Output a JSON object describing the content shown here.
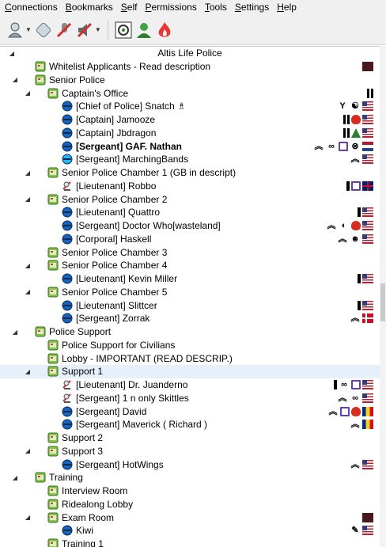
{
  "menu": [
    {
      "u": "C",
      "rest": "onnections"
    },
    {
      "u": "B",
      "rest": "ookmarks"
    },
    {
      "u": "S",
      "rest": "elf"
    },
    {
      "u": "P",
      "rest": "ermissions"
    },
    {
      "u": "T",
      "rest": "ools"
    },
    {
      "u": "S",
      "rest": "ettings"
    },
    {
      "u": "H",
      "rest": "elp"
    }
  ],
  "toolbar": [
    "connect-icon",
    "disconnect-icon",
    "mute-icon",
    "deafen-icon",
    "target-icon",
    "user-info-icon",
    "fire-icon"
  ],
  "root": "Altis Life Police",
  "tree": [
    {
      "type": "channel",
      "depth": 1,
      "label": "Whitelist Applicants - Read description",
      "badges": [
        "m"
      ]
    },
    {
      "type": "channel",
      "depth": 1,
      "label": "Senior Police",
      "expanded": true,
      "badges": []
    },
    {
      "type": "channel",
      "depth": 2,
      "label": "Captain's Office",
      "expanded": true,
      "badges": [
        "pause"
      ]
    },
    {
      "type": "user",
      "depth": 3,
      "label": "[Chief of Police] Snatch ♗",
      "badges": [
        "eagle",
        "yin",
        "us"
      ]
    },
    {
      "type": "user",
      "depth": 3,
      "label": "[Captain] Jamooze",
      "badges": [
        "pause",
        "red",
        "us"
      ]
    },
    {
      "type": "user",
      "depth": 3,
      "label": "[Captain] Jbdragon",
      "badges": [
        "pause",
        "tri",
        "us"
      ]
    },
    {
      "type": "user",
      "depth": 3,
      "label": "[Sergeant] GAF. Nathan",
      "bold": true,
      "badges": [
        "chev",
        "link",
        "twitch",
        "swirl",
        "nl"
      ]
    },
    {
      "type": "user",
      "depth": 3,
      "label": "[Sergeant] MarchingBands",
      "talking": true,
      "badges": [
        "chev",
        "us"
      ]
    },
    {
      "type": "channel",
      "depth": 2,
      "label": "Senior Police Chamber 1 (GB in descript)",
      "expanded": true,
      "badges": []
    },
    {
      "type": "muted",
      "depth": 3,
      "label": "[Lieutenant] Robbo",
      "badges": [
        "bar",
        "twitch",
        "uk"
      ]
    },
    {
      "type": "channel",
      "depth": 2,
      "label": "Senior Police Chamber 2",
      "expanded": true,
      "badges": []
    },
    {
      "type": "user",
      "depth": 3,
      "label": "[Lieutenant] Quattro",
      "badges": [
        "bar",
        "us"
      ]
    },
    {
      "type": "user",
      "depth": 3,
      "label": "[Sergeant] Doctor Who[wasteland]",
      "badges": [
        "chev",
        "crescent",
        "red",
        "us"
      ]
    },
    {
      "type": "user",
      "depth": 3,
      "label": "[Corporal] Haskell",
      "badges": [
        "chev",
        "skull",
        "us"
      ]
    },
    {
      "type": "channel",
      "depth": 2,
      "label": "Senior Police Chamber 3",
      "badges": []
    },
    {
      "type": "channel",
      "depth": 2,
      "label": "Senior Police Chamber 4",
      "expanded": true,
      "badges": []
    },
    {
      "type": "user",
      "depth": 3,
      "label": "[Lieutenant] Kevin Miller",
      "badges": [
        "bar",
        "us"
      ]
    },
    {
      "type": "channel",
      "depth": 2,
      "label": "Senior Police Chamber 5",
      "expanded": true,
      "badges": []
    },
    {
      "type": "user",
      "depth": 3,
      "label": "[Lieutenant] Slittcer",
      "badges": [
        "bar",
        "us"
      ]
    },
    {
      "type": "user",
      "depth": 3,
      "label": "[Sergeant] Zorrak",
      "badges": [
        "chev",
        "dk"
      ]
    },
    {
      "type": "channel",
      "depth": 1,
      "label": "Police Support",
      "expanded": true,
      "badges": []
    },
    {
      "type": "channel",
      "depth": 2,
      "label": "Police Support for Civilians",
      "badges": []
    },
    {
      "type": "channel",
      "depth": 2,
      "label": "Lobby - IMPORTANT (READ DESCRIP.)",
      "badges": []
    },
    {
      "type": "channel",
      "depth": 2,
      "label": "Support 1",
      "expanded": true,
      "selected": true,
      "badges": []
    },
    {
      "type": "muted",
      "depth": 3,
      "label": "[Lieutenant] Dr. Juanderno",
      "badges": [
        "bar",
        "link",
        "twitch",
        "us"
      ]
    },
    {
      "type": "muted",
      "depth": 3,
      "label": "[Sergeant] 1 n only Skittles",
      "badges": [
        "chev",
        "link",
        "us"
      ]
    },
    {
      "type": "user",
      "depth": 3,
      "label": "[Sergeant] David",
      "badges": [
        "chev",
        "twitch",
        "red",
        "ro"
      ]
    },
    {
      "type": "user",
      "depth": 3,
      "label": "[Sergeant] Maverick ( Richard )",
      "badges": [
        "chev",
        "ro"
      ]
    },
    {
      "type": "channel",
      "depth": 2,
      "label": "Support 2",
      "badges": []
    },
    {
      "type": "channel",
      "depth": 2,
      "label": "Support 3",
      "expanded": true,
      "badges": []
    },
    {
      "type": "user",
      "depth": 3,
      "label": "[Sergeant] HotWings",
      "badges": [
        "chev",
        "us"
      ]
    },
    {
      "type": "channel",
      "depth": 1,
      "label": "Training",
      "expanded": true,
      "badges": []
    },
    {
      "type": "channel",
      "depth": 2,
      "label": "Interview Room",
      "badges": []
    },
    {
      "type": "channel",
      "depth": 2,
      "label": "Ridealong Lobby",
      "badges": []
    },
    {
      "type": "channel",
      "depth": 2,
      "label": "Exam Room",
      "expanded": true,
      "badges": [
        "m"
      ]
    },
    {
      "type": "user",
      "depth": 3,
      "label": "Kiwi",
      "badges": [
        "wrench",
        "us"
      ]
    },
    {
      "type": "channel",
      "depth": 2,
      "label": "Training 1",
      "badges": []
    }
  ]
}
